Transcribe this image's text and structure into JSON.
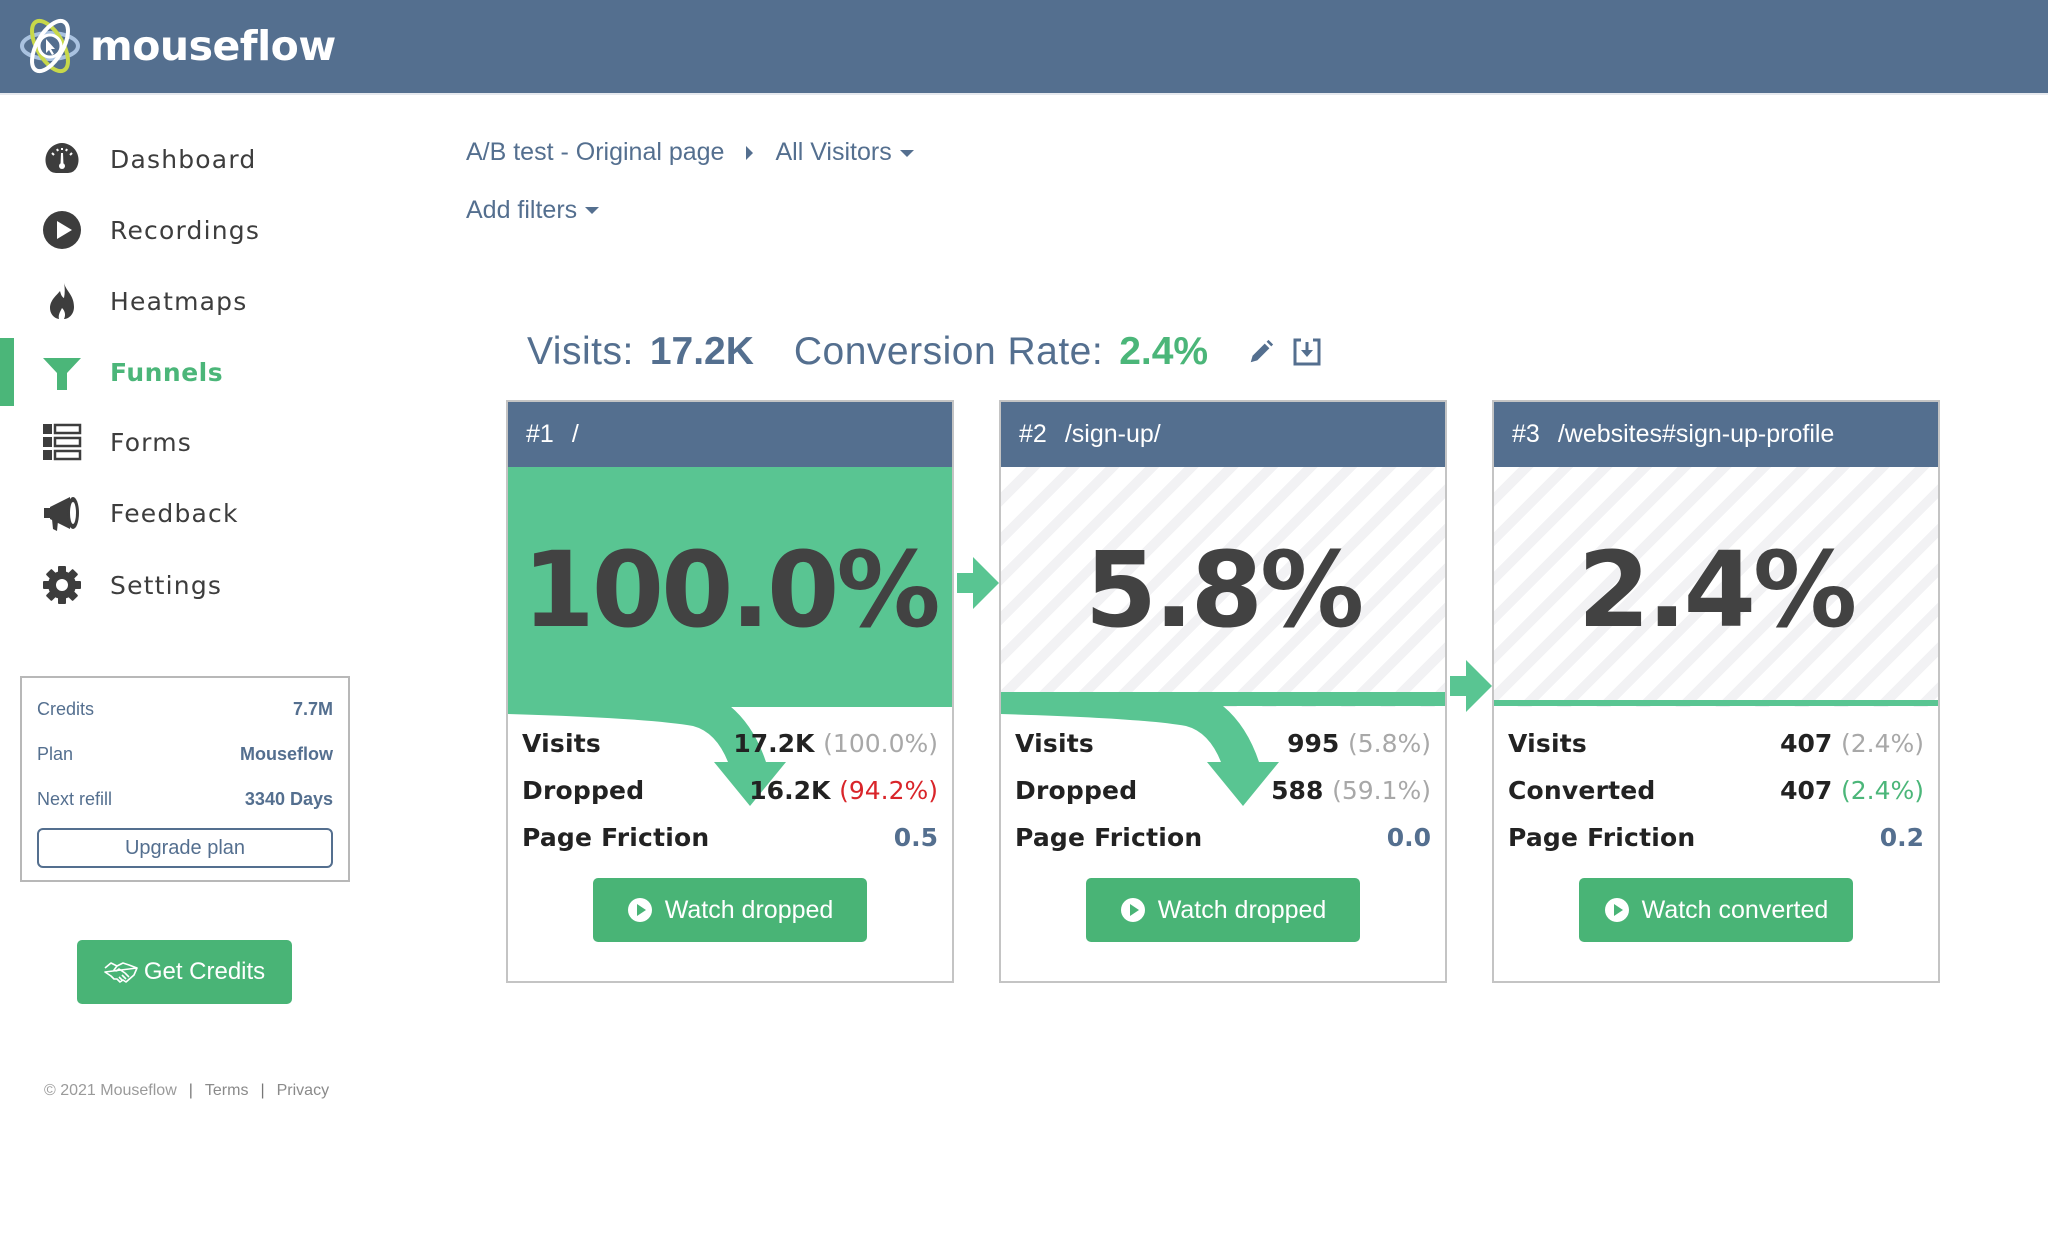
{
  "app": {
    "brand": "mouseflow"
  },
  "colors": {
    "header": "#546f8f",
    "accent_green": "#4bb679",
    "funnel_green": "#59c592",
    "drop_red": "#d9252a",
    "muted_gray": "#a8a8a8"
  },
  "sidebar": {
    "items": [
      {
        "label": "Dashboard",
        "icon": "gauge-icon",
        "active": false
      },
      {
        "label": "Recordings",
        "icon": "play-circle-icon",
        "active": false
      },
      {
        "label": "Heatmaps",
        "icon": "flame-icon",
        "active": false
      },
      {
        "label": "Funnels",
        "icon": "funnel-icon",
        "active": true
      },
      {
        "label": "Forms",
        "icon": "form-list-icon",
        "active": false
      },
      {
        "label": "Feedback",
        "icon": "megaphone-icon",
        "active": false
      },
      {
        "label": "Settings",
        "icon": "gear-icon",
        "active": false
      }
    ],
    "credits": {
      "rows": [
        {
          "label": "Credits",
          "value": "7.7M"
        },
        {
          "label": "Plan",
          "value": "Mouseflow"
        },
        {
          "label": "Next refill",
          "value": "3340 Days"
        }
      ],
      "upgrade_label": "Upgrade plan"
    },
    "get_credits_label": "Get Credits",
    "footer": {
      "copyright": "© 2021 Mouseflow",
      "terms": "Terms",
      "privacy": "Privacy"
    }
  },
  "main": {
    "breadcrumb": {
      "page": "A/B test - Original page",
      "segment": "All Visitors"
    },
    "add_filters_label": "Add filters",
    "summary": {
      "visits_label": "Visits:",
      "visits_value": "17.2K",
      "conversion_label": "Conversion Rate:",
      "conversion_value": "2.4%",
      "edit_icon": "pencil-icon",
      "export_icon": "download-icon"
    },
    "funnel_steps": [
      {
        "step": "#1",
        "url": "/",
        "percent": "100.0%",
        "fill_fraction": 1.0,
        "rows": [
          {
            "label": "Visits",
            "count": "17.2K",
            "pct": "(100.0%)",
            "pct_style": "gray"
          },
          {
            "label": "Dropped",
            "count": "16.2K",
            "pct": "(94.2%)",
            "pct_style": "red"
          },
          {
            "label": "Page Friction",
            "count": "0.5",
            "pct": "",
            "pct_style": "friction"
          }
        ],
        "button_label": "Watch dropped"
      },
      {
        "step": "#2",
        "url": "/sign-up/",
        "percent": "5.8%",
        "fill_fraction": 0.058,
        "rows": [
          {
            "label": "Visits",
            "count": "995",
            "pct": "(5.8%)",
            "pct_style": "gray"
          },
          {
            "label": "Dropped",
            "count": "588",
            "pct": "(59.1%)",
            "pct_style": "gray"
          },
          {
            "label": "Page Friction",
            "count": "0.0",
            "pct": "",
            "pct_style": "friction"
          }
        ],
        "button_label": "Watch dropped"
      },
      {
        "step": "#3",
        "url": "/websites#sign-up-profile",
        "percent": "2.4%",
        "fill_fraction": 0.024,
        "rows": [
          {
            "label": "Visits",
            "count": "407",
            "pct": "(2.4%)",
            "pct_style": "gray"
          },
          {
            "label": "Converted",
            "count": "407",
            "pct": "(2.4%)",
            "pct_style": "green"
          },
          {
            "label": "Page Friction",
            "count": "0.2",
            "pct": "",
            "pct_style": "friction"
          }
        ],
        "button_label": "Watch converted"
      }
    ]
  }
}
